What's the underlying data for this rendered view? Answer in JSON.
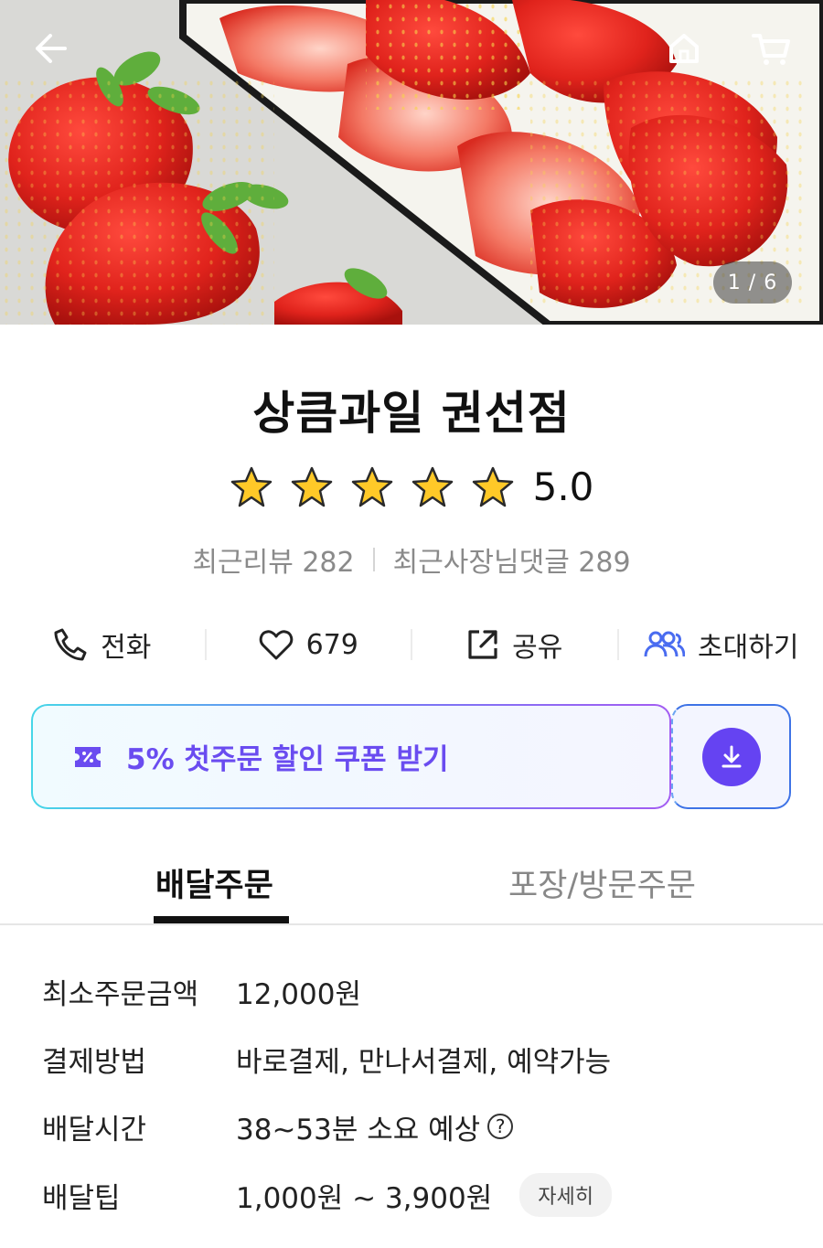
{
  "hero": {
    "counter": "1 / 6"
  },
  "store": {
    "name": "상큼과일 권선점",
    "rating": "5.0",
    "star_count": 5,
    "recent_reviews_label": "최근리뷰 282",
    "owner_replies_label": "최근사장님댓글 289"
  },
  "actions": {
    "call": "전화",
    "like_count": "679",
    "share": "공유",
    "invite": "초대하기"
  },
  "coupon": {
    "text": "5% 첫주문 할인 쿠폰 받기"
  },
  "tabs": {
    "delivery": "배달주문",
    "pickup": "포장/방문주문"
  },
  "info": {
    "min_order_label": "최소주문금액",
    "min_order_value": "12,000원",
    "payment_label": "결제방법",
    "payment_value": "바로결제, 만나서결제, 예약가능",
    "delivery_time_label": "배달시간",
    "delivery_time_value": "38~53분 소요 예상",
    "delivery_tip_label": "배달팁",
    "delivery_tip_value": "1,000원 ~ 3,900원",
    "detail_button": "자세히"
  },
  "colors": {
    "coupon_text": "#6a4cf0",
    "download_button": "#6543f2",
    "invite_icon": "#4a6cf0"
  }
}
